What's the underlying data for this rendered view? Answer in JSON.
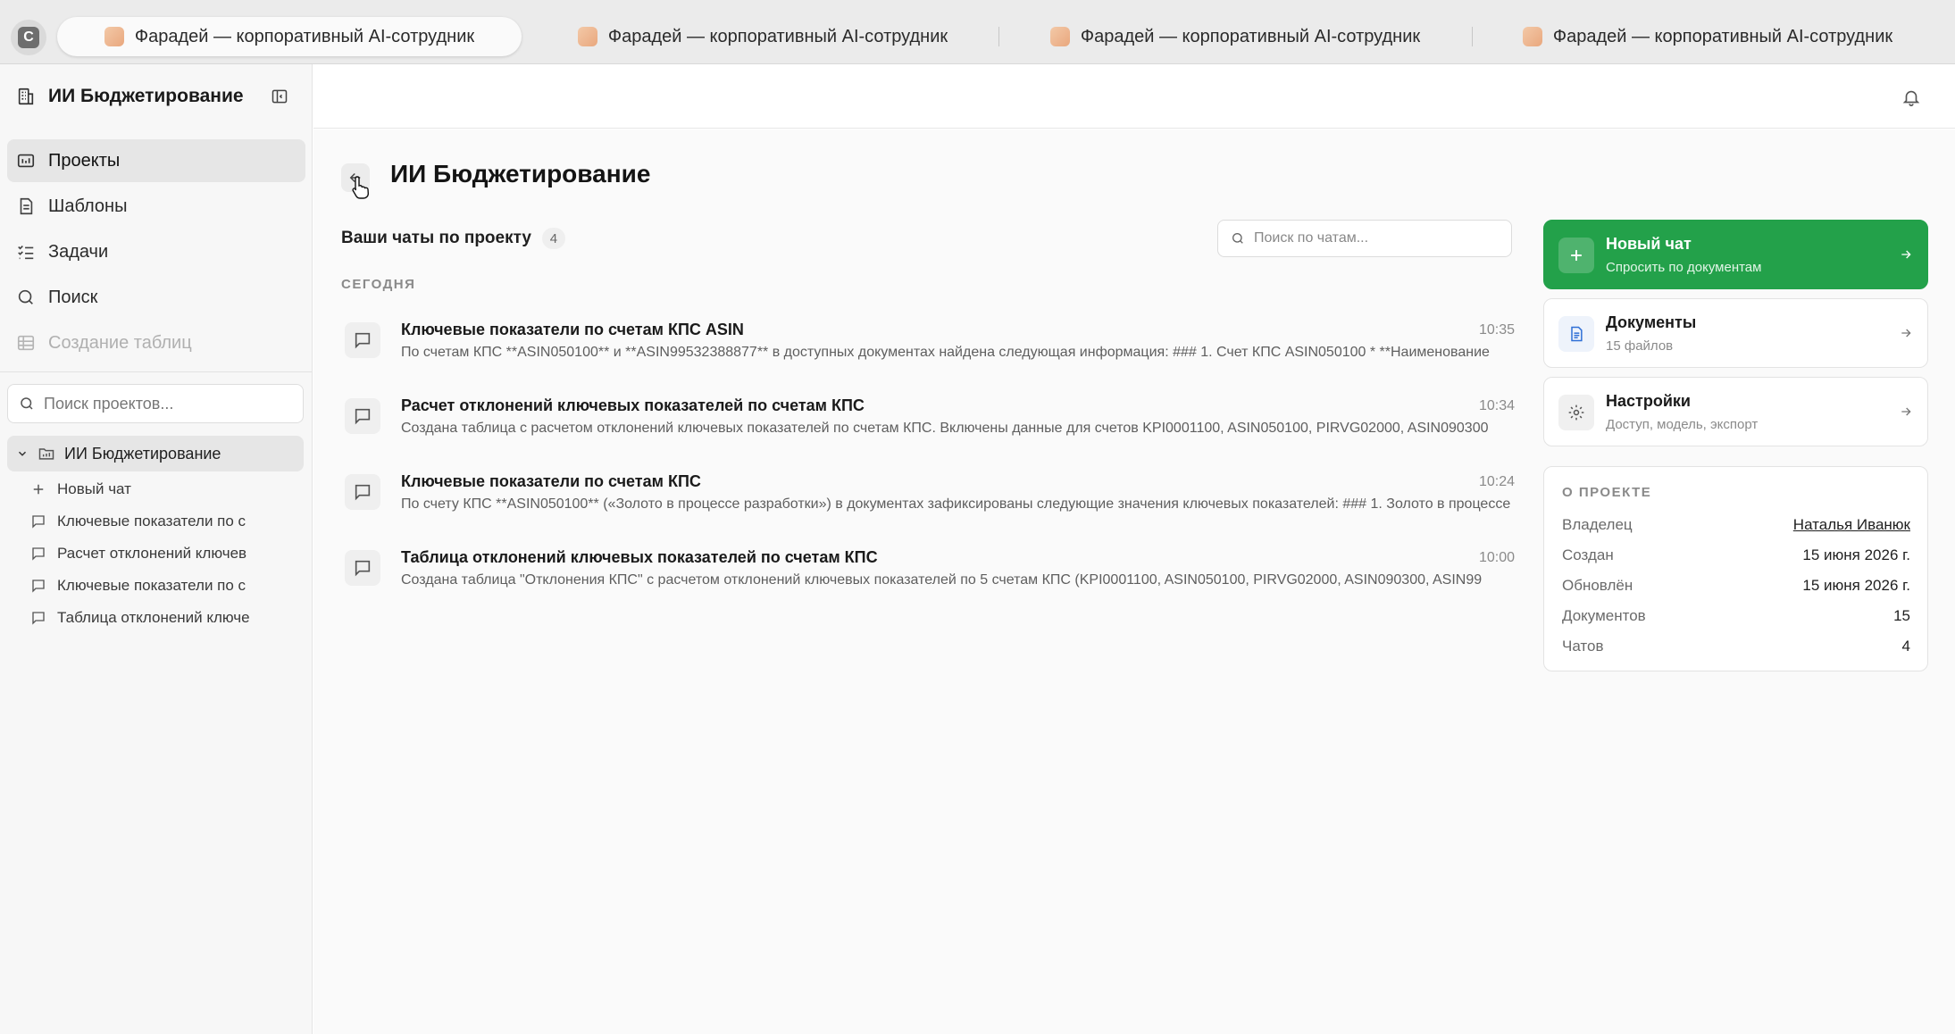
{
  "browser": {
    "app_badge": "C",
    "tabs": [
      {
        "title": "Фарадей — корпоративный AI-сотрудник",
        "active": true
      },
      {
        "title": "Фарадей — корпоративный AI-сотрудник",
        "active": false
      },
      {
        "title": "Фарадей — корпоративный AI-сотрудник",
        "active": false
      },
      {
        "title": "Фарадей — корпоративный AI-сотрудник",
        "active": false
      }
    ]
  },
  "sidebar": {
    "workspace_title": "ИИ Бюджетирование",
    "nav": [
      {
        "label": "Проекты",
        "icon": "projects-icon",
        "active": true
      },
      {
        "label": "Шаблоны",
        "icon": "templates-icon"
      },
      {
        "label": "Задачи",
        "icon": "tasks-icon"
      },
      {
        "label": "Поиск",
        "icon": "search-icon"
      },
      {
        "label": "Создание таблиц",
        "icon": "table-icon",
        "disabled": true
      }
    ],
    "project_search_placeholder": "Поиск проектов...",
    "project": {
      "name": "ИИ Бюджетирование",
      "new_chat_label": "Новый чат",
      "chats": [
        "Ключевые показатели по с",
        "Расчет отклонений ключев",
        "Ключевые показатели по с",
        "Таблица отклонений ключе"
      ]
    }
  },
  "main": {
    "title": "ИИ Бюджетирование",
    "chats_label": "Ваши чаты по проекту",
    "chats_count": "4",
    "chat_search_placeholder": "Поиск по чатам...",
    "section_today": "СЕГОДНЯ",
    "chats": [
      {
        "title": "Ключевые показатели по счетам КПС ASIN",
        "time": "10:35",
        "snippet": "По счетам КПС **ASIN050100** и **ASIN99532388877** в доступных документах найдена следующая информация: ### 1. Счет КПС ASIN050100 * **Наименование"
      },
      {
        "title": "Расчет отклонений ключевых показателей по счетам КПС",
        "time": "10:34",
        "snippet": "Создана таблица с расчетом отклонений ключевых показателей по счетам КПС. Включены данные для счетов KPI0001100, ASIN050100, PIRVG02000, ASIN090300"
      },
      {
        "title": "Ключевые показатели по счетам КПС",
        "time": "10:24",
        "snippet": "По счету КПС **ASIN050100** («Золото в процессе разработки») в документах зафиксированы следующие значения ключевых показателей: ### 1. Золото в процессе"
      },
      {
        "title": "Таблица отклонений ключевых показателей по счетам КПС",
        "time": "10:00",
        "snippet": "Создана таблица \"Отклонения КПС\" с расчетом отклонений ключевых показателей по 5 счетам КПС (KPI0001100, ASIN050100, PIRVG02000, ASIN090300, ASIN99"
      }
    ]
  },
  "panel": {
    "new_chat": {
      "title": "Новый чат",
      "subtitle": "Спросить по документам"
    },
    "documents": {
      "title": "Документы",
      "subtitle": "15 файлов"
    },
    "settings": {
      "title": "Настройки",
      "subtitle": "Доступ, модель, экспорт"
    },
    "about": {
      "heading": "О ПРОЕКТЕ",
      "rows": [
        {
          "key": "Владелец",
          "value": "Наталья Иванюк"
        },
        {
          "key": "Создан",
          "value": "15 июня 2026 г."
        },
        {
          "key": "Обновлён",
          "value": "15 июня 2026 г."
        },
        {
          "key": "Документов",
          "value": "15"
        },
        {
          "key": "Чатов",
          "value": "4"
        }
      ]
    }
  },
  "colors": {
    "accent_green": "#23a14a",
    "sidebar_bg": "#f7f7f7",
    "active_item_bg": "#e6e6e6"
  }
}
